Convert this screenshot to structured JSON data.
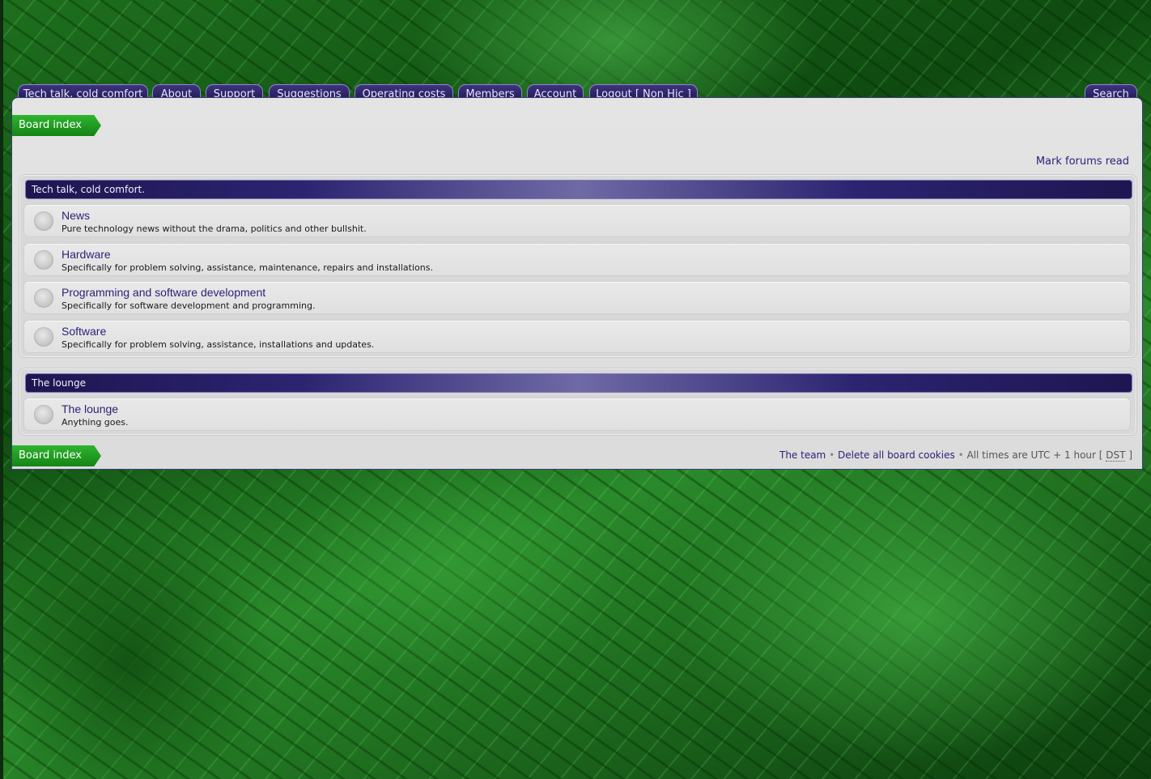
{
  "nav": {
    "tabs": [
      {
        "label": "Tech talk, cold comfort"
      },
      {
        "label": "About"
      },
      {
        "label": "Support"
      },
      {
        "label": "Suggestions"
      },
      {
        "label": "Operating costs"
      },
      {
        "label": "Members"
      },
      {
        "label": "Account"
      },
      {
        "label": "Logout [ Non Hic ]"
      }
    ],
    "search_label": "Search"
  },
  "breadcrumb": {
    "label": "Board index"
  },
  "mark_forums_read": "Mark forums read",
  "categories": [
    {
      "title": "Tech talk, cold comfort.",
      "forums": [
        {
          "name": "News",
          "description": "Pure technology news without the drama, politics and other bullshit."
        },
        {
          "name": "Hardware",
          "description": "Specifically for problem solving, assistance, maintenance, repairs and installations."
        },
        {
          "name": "Programming and software development",
          "description": "Specifically for software development and programming."
        },
        {
          "name": "Software",
          "description": "Specifically for problem solving, assistance, installations and updates."
        }
      ]
    },
    {
      "title": "The lounge",
      "forums": [
        {
          "name": "The lounge",
          "description": "Anything goes."
        }
      ]
    }
  ],
  "footer": {
    "team_link": "The team",
    "separator": "•",
    "delete_cookies_link": "Delete all board cookies",
    "timezone_prefix": "All times are UTC + 1 hour [",
    "dst": "DST",
    "timezone_suffix": "]"
  },
  "colors": {
    "tab_bg": "#2a2160",
    "link": "#2b2378",
    "crumb_green": "#148414",
    "background_green": "#1e6f1e"
  }
}
